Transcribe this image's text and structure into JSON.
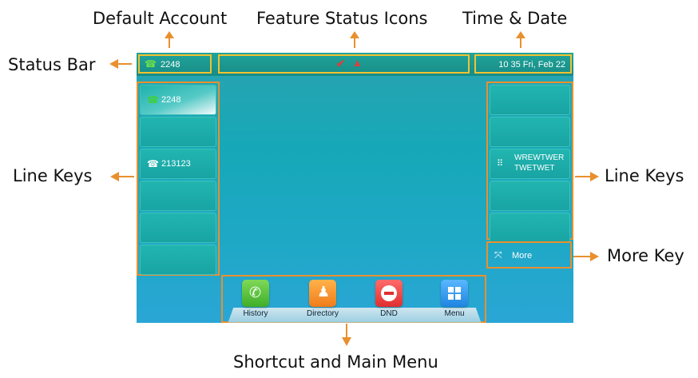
{
  "callouts": {
    "default_account": "Default Account",
    "feature_status_icons": "Feature Status Icons",
    "time_date": "Time & Date",
    "status_bar": "Status Bar",
    "line_keys_left": "Line Keys",
    "line_keys_right": "Line Keys",
    "more_key": "More Key",
    "shortcut_menu": "Shortcut and Main Menu"
  },
  "screen": {
    "status": {
      "account": "2248",
      "time": "10 35 Fri, Feb 22"
    },
    "left_keys": [
      "2248",
      "",
      "213123",
      "",
      "",
      ""
    ],
    "right_keys": {
      "key3_line1": "WREWTWER",
      "key3_line2": "TWETWET"
    },
    "more_label": "More",
    "menu": [
      "History",
      "Directory",
      "DND",
      "Menu"
    ]
  },
  "colors": {
    "highlight_yellow": "#f1c232",
    "highlight_orange": "#e8902e",
    "screen_teal": "#16a8b8"
  }
}
